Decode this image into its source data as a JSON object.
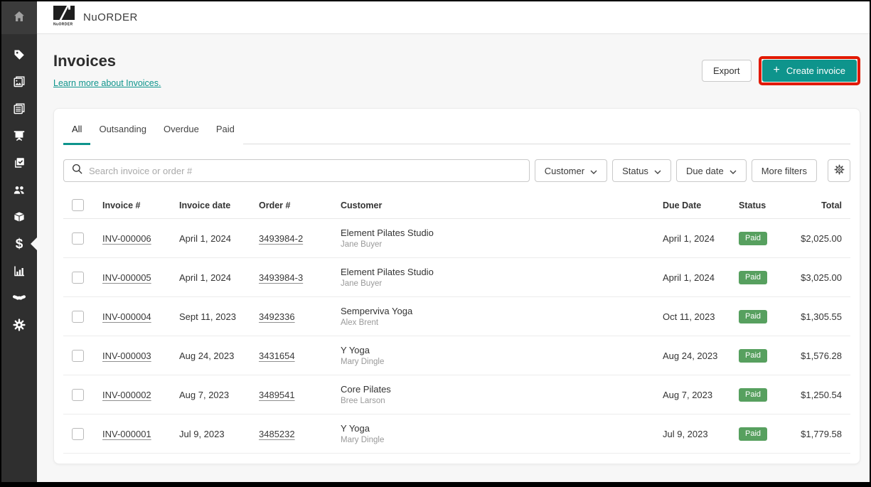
{
  "brand": {
    "wordmark": "NuORDER",
    "logo_text": "NuORDER"
  },
  "sidebar": {
    "items": [
      "home",
      "products-tag",
      "catalogs",
      "linesheets",
      "presentations",
      "orders",
      "customers",
      "inventory",
      "payments",
      "analytics",
      "partners",
      "settings"
    ],
    "active_item": "payments"
  },
  "page": {
    "title": "Invoices",
    "learn_more": "Learn more about Invoices."
  },
  "actions": {
    "export": "Export",
    "create_invoice": "Create invoice",
    "create_invoice_icon": "plus-icon"
  },
  "tabs": [
    {
      "label": "All",
      "active": true
    },
    {
      "label": "Outsanding",
      "active": false
    },
    {
      "label": "Overdue",
      "active": false
    },
    {
      "label": "Paid",
      "active": false
    }
  ],
  "search": {
    "placeholder": "Search invoice or order #",
    "icon": "search-icon"
  },
  "filters": [
    {
      "label": "Customer",
      "has_dropdown": true
    },
    {
      "label": "Status",
      "has_dropdown": true
    },
    {
      "label": "Due date",
      "has_dropdown": true
    },
    {
      "label": "More filters",
      "has_dropdown": false
    }
  ],
  "table": {
    "columns": [
      "Invoice #",
      "Invoice date",
      "Order #",
      "Customer",
      "Due Date",
      "Status",
      "Total"
    ],
    "rows": [
      {
        "invoice": "INV-000006",
        "invoice_date": "April 1, 2024",
        "order": "3493984-2",
        "customer": "Element Pilates Studio",
        "contact": "Jane Buyer",
        "due_date": "April 1, 2024",
        "status": "Paid",
        "total": "$2,025.00"
      },
      {
        "invoice": "INV-000005",
        "invoice_date": "April 1, 2024",
        "order": "3493984-3",
        "customer": "Element Pilates Studio",
        "contact": "Jane Buyer",
        "due_date": "April 1, 2024",
        "status": "Paid",
        "total": "$3,025.00"
      },
      {
        "invoice": "INV-000004",
        "invoice_date": "Sept 11, 2023",
        "order": "3492336",
        "customer": "Semperviva Yoga",
        "contact": "Alex Brent",
        "due_date": "Oct 11, 2023",
        "status": "Paid",
        "total": "$1,305.55"
      },
      {
        "invoice": "INV-000003",
        "invoice_date": "Aug 24, 2023",
        "order": "3431654",
        "customer": "Y Yoga",
        "contact": "Mary Dingle",
        "due_date": "Aug 24, 2023",
        "status": "Paid",
        "total": "$1,576.28"
      },
      {
        "invoice": "INV-000002",
        "invoice_date": "Aug 7, 2023",
        "order": "3489541",
        "customer": "Core Pilates",
        "contact": "Bree Larson",
        "due_date": "Aug 7, 2023",
        "status": "Paid",
        "total": "$1,250.54"
      },
      {
        "invoice": "INV-000001",
        "invoice_date": "Jul 9, 2023",
        "order": "3485232",
        "customer": "Y Yoga",
        "contact": "Mary Dingle",
        "due_date": "Jul 9, 2023",
        "status": "Paid",
        "total": "$1,779.58"
      }
    ]
  },
  "colors": {
    "accent_teal": "#0e948c",
    "badge_green": "#57a05f",
    "annotation_red": "#e11900",
    "sidebar_bg": "#2f2f2f"
  }
}
